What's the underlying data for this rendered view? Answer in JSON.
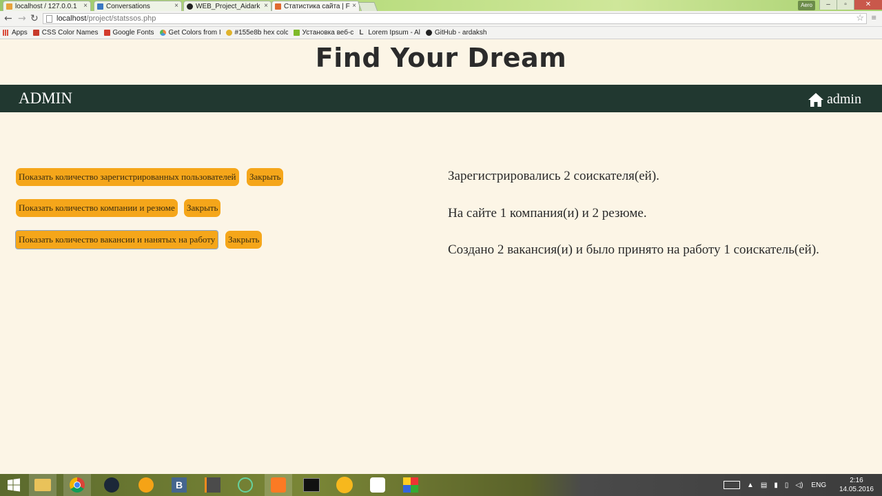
{
  "browser": {
    "tabs": [
      {
        "title": "localhost / 127.0.0.1",
        "icon": "phpmyadmin-icon",
        "color": "#e8a33b"
      },
      {
        "title": "Conversations",
        "icon": "conversations-icon",
        "color": "#3b78c2"
      },
      {
        "title": "WEB_Project_Aidark",
        "icon": "github-icon",
        "color": "#222222"
      },
      {
        "title": "Статистика сайта | F",
        "icon": "site-icon",
        "color": "#e0692f"
      }
    ],
    "window_user": "Aero",
    "url_host": "localhost",
    "url_path": "/project/statssos.php",
    "bookmarks": [
      {
        "label": "Apps",
        "icon": "apps-grid-icon",
        "color": "#d94b3b"
      },
      {
        "label": "CSS Color Names",
        "icon": "css-icon",
        "color": "#c83a2b"
      },
      {
        "label": "Google Fonts",
        "icon": "google-fonts-icon",
        "color": "#d33b2c"
      },
      {
        "label": "Get Colors from I",
        "icon": "colors-icon",
        "color": "#4a9ad8"
      },
      {
        "label": "#155e8b hex colc",
        "icon": "hex-color-icon",
        "color": "#e0b32c"
      },
      {
        "label": "Установка веб-с",
        "icon": "install-icon",
        "color": "#7fba2a"
      },
      {
        "label": "Lorem Ipsum - Al",
        "icon": "lorem-icon",
        "color": "#444444"
      },
      {
        "label": "GitHub - ardaksh",
        "icon": "github-icon",
        "color": "#222222"
      }
    ]
  },
  "page": {
    "title": "Find Your Dream",
    "brand": "ADMIN",
    "user": "admin"
  },
  "actions": [
    {
      "show_label": "Показать количество зарегистрированных пользователей",
      "close_label": "Закрыть"
    },
    {
      "show_label": "Показать количество компании и резюме",
      "close_label": "Закрыть"
    },
    {
      "show_label": "Показать количество вакансии и нанятых на работу",
      "close_label": "Закрыть"
    }
  ],
  "stats": [
    "Зарегистрировались 2 соискателя(ей).",
    "На сайте 1 компания(и) и 2 резюме.",
    "Создано 2 вакансия(и) и было принято на работу 1 соискатель(ей)."
  ],
  "taskbar": {
    "language": "ENG",
    "time": "2:16",
    "date": "14.05.2016"
  },
  "colors": {
    "accent": "#f5a61a",
    "navbar": "#213830",
    "background": "#fcf5e6"
  }
}
